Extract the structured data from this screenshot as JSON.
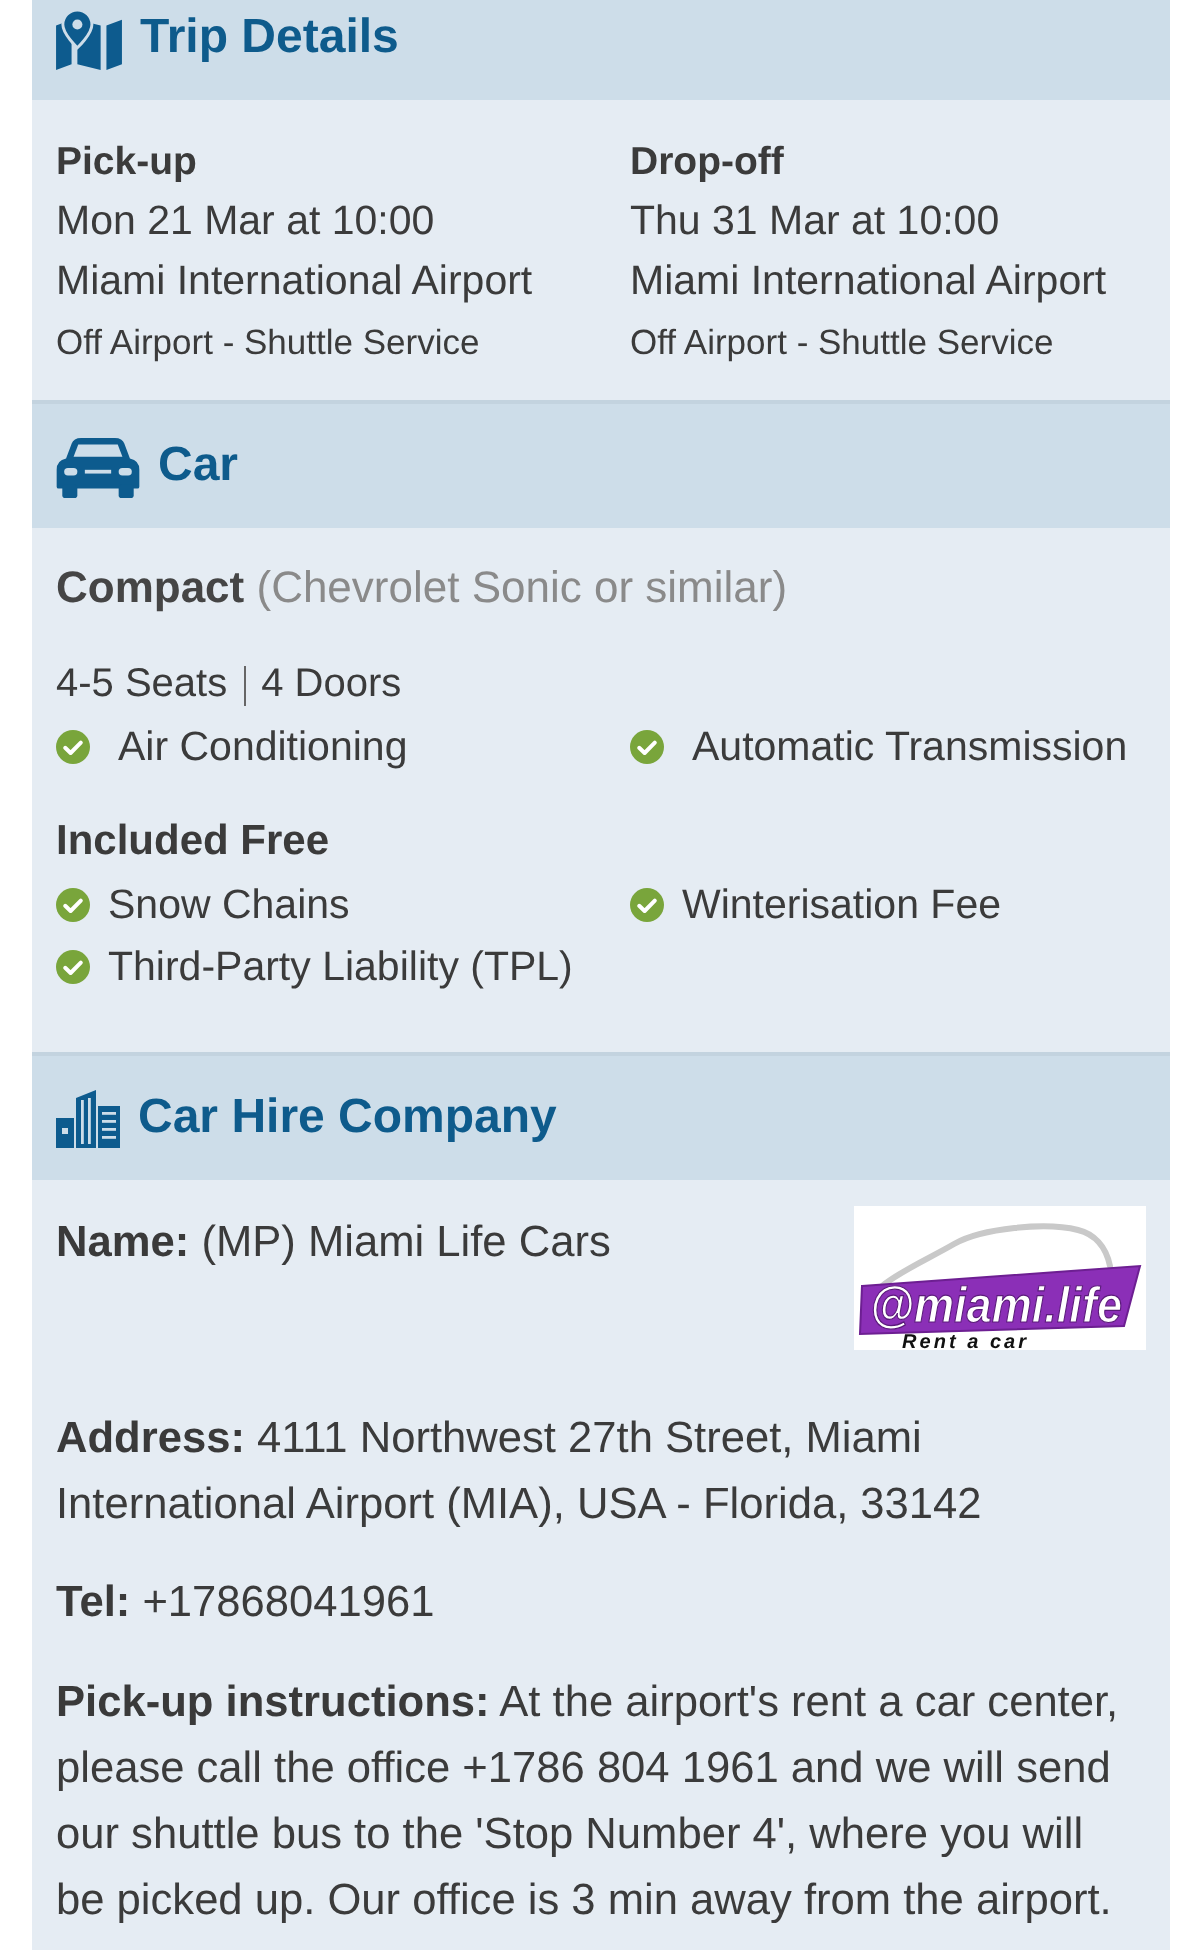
{
  "trip_details": {
    "title": "Trip Details",
    "stops": [
      {
        "label": "Pick-up",
        "datetime": "Mon 21 Mar at 10:00",
        "location": "Miami International Airport",
        "service": "Off Airport - Shuttle Service"
      },
      {
        "label": "Drop-off",
        "datetime": "Thu 31 Mar at 10:00",
        "location": "Miami International Airport",
        "service": "Off Airport - Shuttle Service"
      }
    ]
  },
  "car": {
    "title": "Car",
    "model": "**Compact** (Chevrolet Sonic or similar)",
    "specs": [
      "4-5 Seats",
      "4 Doors"
    ],
    "features": [
      "Air Conditioning",
      "Automatic Transmission"
    ],
    "included_free": {
      "title": "Included Free",
      "items": [
        "Snow Chains",
        "Winterisation Fee",
        "Third-Party Liability (TPL)"
      ]
    }
  },
  "car_hire_company": {
    "title": "Car Hire Company",
    "logo": {
      "wordmark": "@miami.life",
      "tagline": "Rent a car"
    },
    "details": [
      "**Name:** (MP) Miami Life Cars",
      "**Address:** 4111 Northwest 27th Street, Miami International Airport (MIA), USA - Florida, 33142",
      "**Tel:** +17868041961",
      "**Pick-up instructions:** At the airport's rent a car center, please call the office +1786 804 1961 and we will send our shuttle bus to the 'Stop Number 4', where you will be picked up. Our office is 3 min away from the airport."
    ]
  }
}
